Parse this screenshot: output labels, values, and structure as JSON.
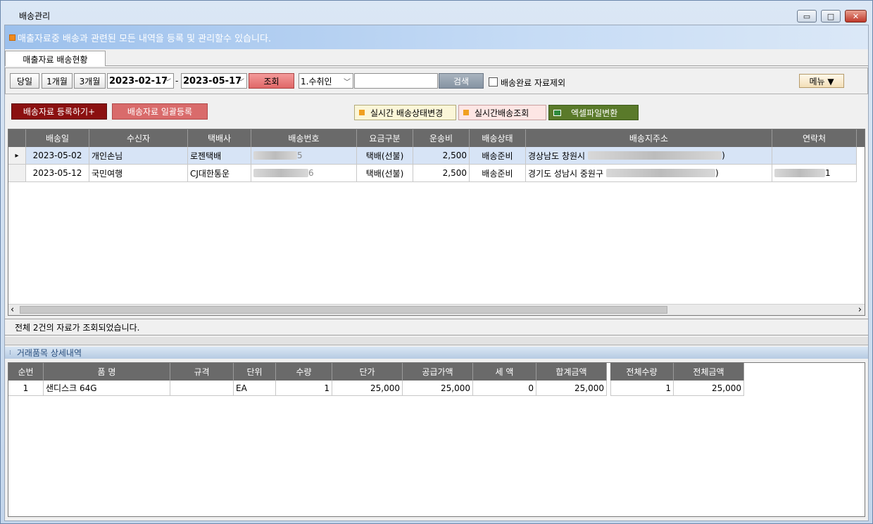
{
  "window": {
    "title": "배송관리",
    "min_icon": "minimize-icon",
    "max_icon": "maximize-icon",
    "close_icon": "close-icon",
    "min_glyph": "▭",
    "max_glyph": "□",
    "close_glyph": "✕"
  },
  "banner": {
    "text": "매출자료중 배송과 관련된 모든 내역을 등록 및 관리할수 있습니다."
  },
  "tab": {
    "label": "매출자료 배송현황"
  },
  "toolbar": {
    "today": "당일",
    "one_month": "1개월",
    "three_month": "3개월",
    "date_from": "2023-02-17",
    "date_sep": "-",
    "date_to": "2023-05-17",
    "query": "조회",
    "search_field": "1.수취인",
    "search_value": "",
    "search": "검색",
    "exclude_done": "배송완료 자료제외",
    "exclude_done_checked": false,
    "menu": "메뉴 ▼",
    "dropdown_glyph": "﹀"
  },
  "actions": {
    "register": "배송자료 등록하기+",
    "bulk_register": "배송자료 일괄등록",
    "realtime_change": "실시간 배송상태변경",
    "realtime_query": "실시간배송조회",
    "excel": "엑셀파일변환"
  },
  "delivery_table": {
    "headers": [
      "배송일",
      "수신자",
      "택배사",
      "배송번호",
      "요금구분",
      "운송비",
      "배송상태",
      "배송지주소",
      "연락처"
    ],
    "rows": [
      {
        "date": "2023-05-02",
        "recipient": "개인손님",
        "courier": "로젠택배",
        "tracking_tail": "5",
        "fee_type": "택배(선불)",
        "fee": "2,500",
        "status": "배송준비",
        "address": "경상남도 창원시",
        "address_tail": ")",
        "phone_tail": ""
      },
      {
        "date": "2023-05-12",
        "recipient": "국민여행",
        "courier": "CJ대한통운",
        "tracking_tail": "6",
        "fee_type": "택배(선불)",
        "fee": "2,500",
        "status": "배송준비",
        "address": "경기도 성남시 중원구",
        "address_tail": ")",
        "phone_tail": "1"
      }
    ],
    "row_marker": "▸",
    "scroll_left": "‹",
    "scroll_right": "›"
  },
  "status_text": "전체 2건의 자료가 조회되었습니다.",
  "detail_section": {
    "title": "거래품목 상세내역"
  },
  "detail_table": {
    "headers": [
      "순번",
      "품        명",
      "규격",
      "단위",
      "수량",
      "단가",
      "공급가액",
      "세    액",
      "합계금액",
      "전체수량",
      "전체금액"
    ],
    "rows": [
      {
        "no": "1",
        "name": "샌디스크 64G",
        "spec": "",
        "unit": "EA",
        "qty": "1",
        "price": "25,000",
        "supply": "25,000",
        "tax": "0",
        "total": "25,000",
        "total_qty": "1",
        "total_amount": "25,000"
      }
    ]
  }
}
